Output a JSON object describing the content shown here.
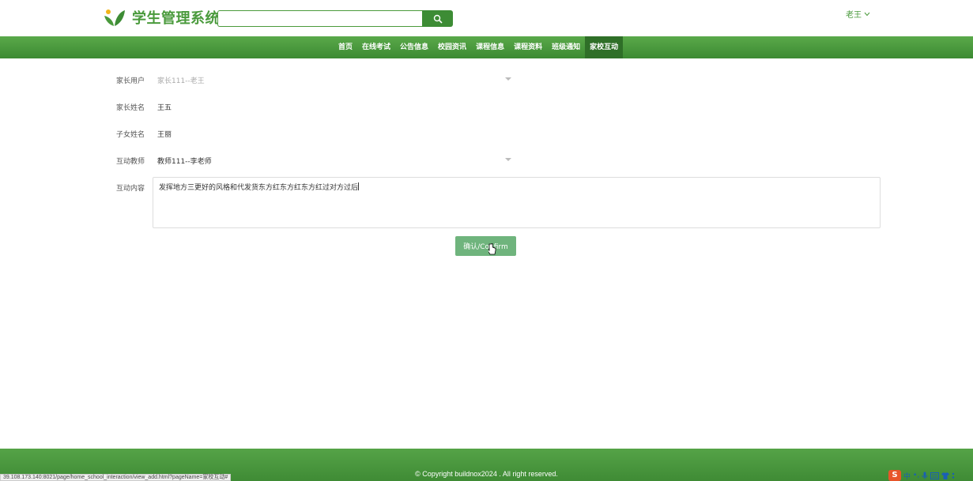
{
  "header": {
    "logo_text": "学生管理系统",
    "search": {
      "value": "",
      "placeholder": ""
    },
    "user_name": "老王"
  },
  "nav": {
    "items": [
      {
        "label": "首页",
        "active": false
      },
      {
        "label": "在线考试",
        "active": false
      },
      {
        "label": "公告信息",
        "active": false
      },
      {
        "label": "校园资讯",
        "active": false
      },
      {
        "label": "课程信息",
        "active": false
      },
      {
        "label": "课程资料",
        "active": false
      },
      {
        "label": "班级通知",
        "active": false
      },
      {
        "label": "家校互动",
        "active": true
      }
    ]
  },
  "form": {
    "parent_user": {
      "label": "家长用户",
      "value": "家长111--老王"
    },
    "parent_name": {
      "label": "家长姓名",
      "value": "王五"
    },
    "child_name": {
      "label": "子女姓名",
      "value": "王丽"
    },
    "teacher": {
      "label": "互动教师",
      "value": "教师111--李老师"
    },
    "content": {
      "label": "互动内容",
      "value": "发挥地方三更好的风格和代发货东方红东方红东方红过对方过后"
    },
    "confirm_label": "确认/Confirm"
  },
  "footer": {
    "copyright": "© Copyright buildnox2024 . All right reserved."
  },
  "statusbar": {
    "url": "39.108.173.140:8021/page/home_school_interaction/view_add.html?pageName=家校互动#"
  },
  "tray": {
    "ime_label": "中"
  },
  "colors": {
    "brand_green": "#4a9a3c",
    "nav_active": "#2f6f28",
    "button_green": "#6fb47d"
  }
}
